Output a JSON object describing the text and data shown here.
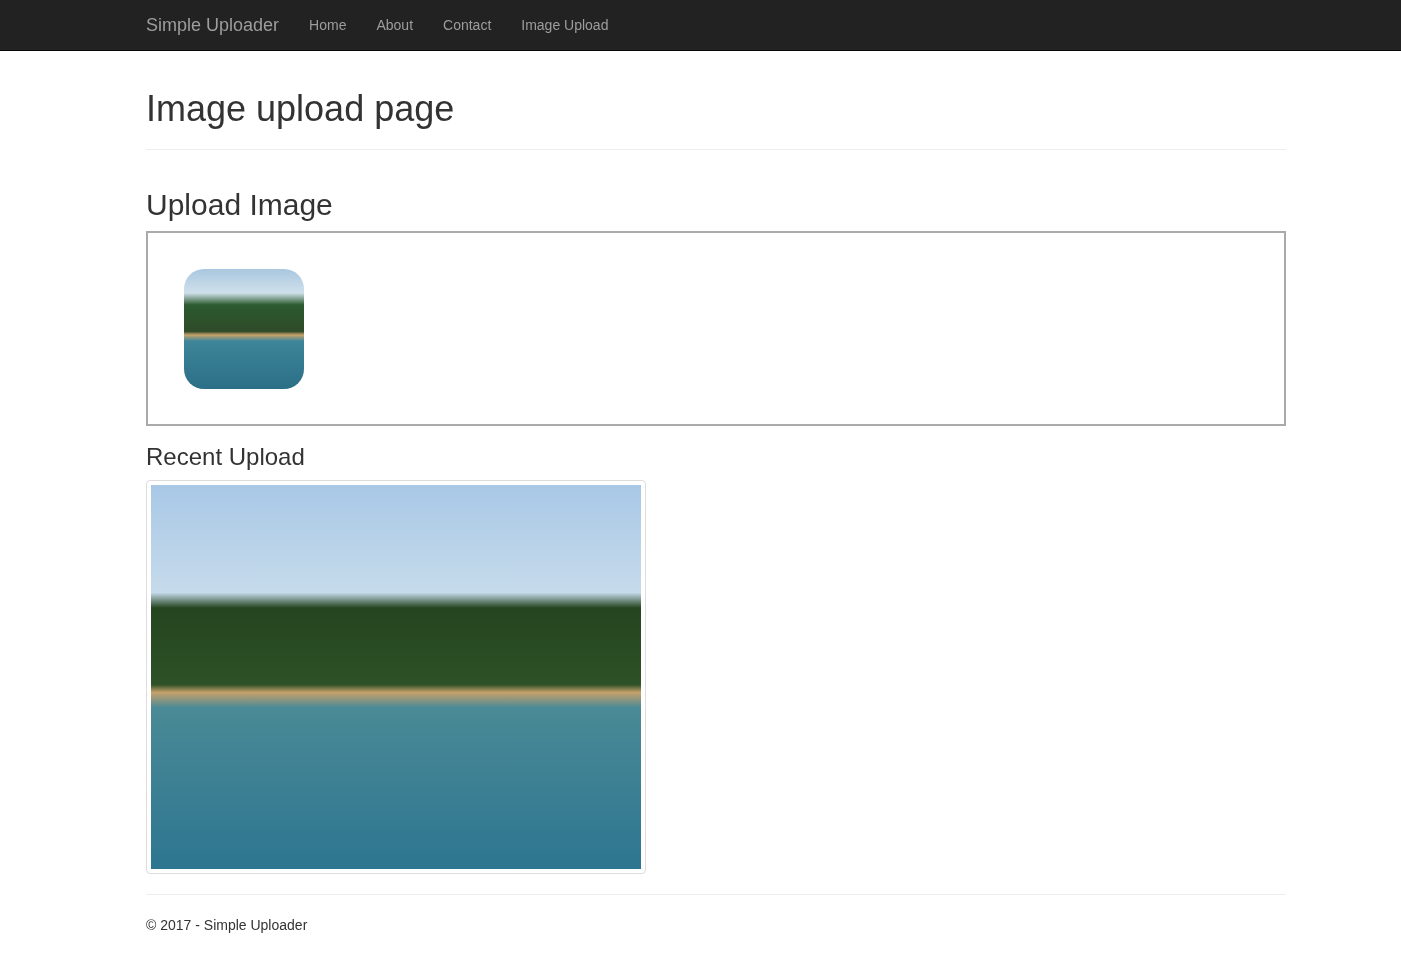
{
  "navbar": {
    "brand": "Simple Uploader",
    "links": [
      {
        "label": "Home"
      },
      {
        "label": "About"
      },
      {
        "label": "Contact"
      },
      {
        "label": "Image Upload"
      }
    ]
  },
  "page_title": "Image upload page",
  "upload": {
    "heading": "Upload Image"
  },
  "recent": {
    "heading": "Recent Upload"
  },
  "footer": {
    "text": "© 2017 - Simple Uploader"
  }
}
